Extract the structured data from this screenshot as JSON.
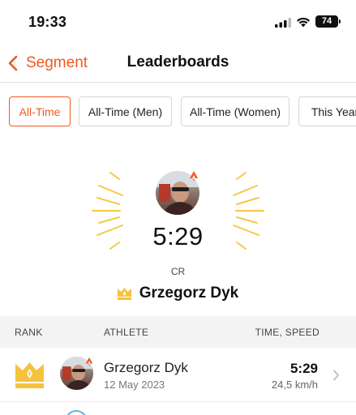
{
  "status_bar": {
    "time": "19:33",
    "battery": "74"
  },
  "nav": {
    "back_label": "Segment",
    "title": "Leaderboards"
  },
  "tabs": [
    {
      "label": "All-Time",
      "active": true
    },
    {
      "label": "All-Time (Men)",
      "active": false
    },
    {
      "label": "All-Time (Women)",
      "active": false
    },
    {
      "label": "This Year",
      "active": false
    }
  ],
  "hero": {
    "time": "5:29",
    "label": "CR",
    "athlete": "Grzegorz Dyk"
  },
  "table": {
    "headers": {
      "rank": "RANK",
      "athlete": "ATHLETE",
      "time_speed": "TIME, SPEED"
    },
    "rows": [
      {
        "name": "Grzegorz Dyk",
        "date": "12 May 2023",
        "time": "5:29",
        "speed": "24,5 km/h"
      }
    ]
  },
  "colors": {
    "accent": "#f0581f",
    "crown": "#f5c23c",
    "rays": "#f5c845"
  },
  "icons": [
    "back-chevron-icon",
    "cellular-signal-icon",
    "wifi-icon",
    "battery-icon",
    "crown-icon",
    "strava-badge-icon",
    "chevron-right-icon"
  ]
}
